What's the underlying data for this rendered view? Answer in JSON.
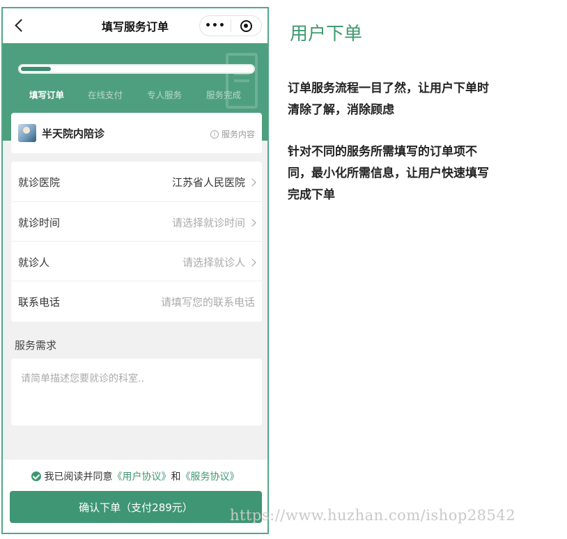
{
  "navbar": {
    "title": "填写服务订单",
    "more_label": "•••"
  },
  "progress": {
    "fraction": 0.13,
    "steps": [
      {
        "label": "填写订单",
        "active": true
      },
      {
        "label": "在线支付",
        "active": false
      },
      {
        "label": "专人服务",
        "active": false
      },
      {
        "label": "服务完成",
        "active": false
      }
    ]
  },
  "service": {
    "name": "半天院内陪诊",
    "info_label": "服务内容",
    "info_icon": "i"
  },
  "form": {
    "rows": [
      {
        "label": "就诊医院",
        "value": "江苏省人民医院",
        "is_placeholder": false
      },
      {
        "label": "就诊时间",
        "value": "请选择就诊时间",
        "is_placeholder": true
      },
      {
        "label": "就诊人",
        "value": "请选择就诊人",
        "is_placeholder": true
      },
      {
        "label": "联系电话",
        "value": "请填写您的联系电话",
        "is_placeholder": true
      }
    ]
  },
  "requirement": {
    "title": "服务需求",
    "placeholder": "请简单描述您要就诊的科室.."
  },
  "agreement": {
    "prefix": "我已阅读并同意",
    "user_link": "《用户协议》",
    "and": "和",
    "service_link": "《服务协议》"
  },
  "confirm": {
    "label": "确认下单（支付289元）"
  },
  "side": {
    "title": "用户下单",
    "paragraph1": "订单服务流程一目了然，让用户下单时清除了解，消除顾虑",
    "paragraph2": "针对不同的服务所需填写的订单项不同，最小化所需信息，让用户快速填写完成下单"
  },
  "watermark": "https://www.huzhan.com/ishop28542",
  "colors": {
    "brand_green": "#4e9f7f",
    "button_green": "#3f9674"
  }
}
